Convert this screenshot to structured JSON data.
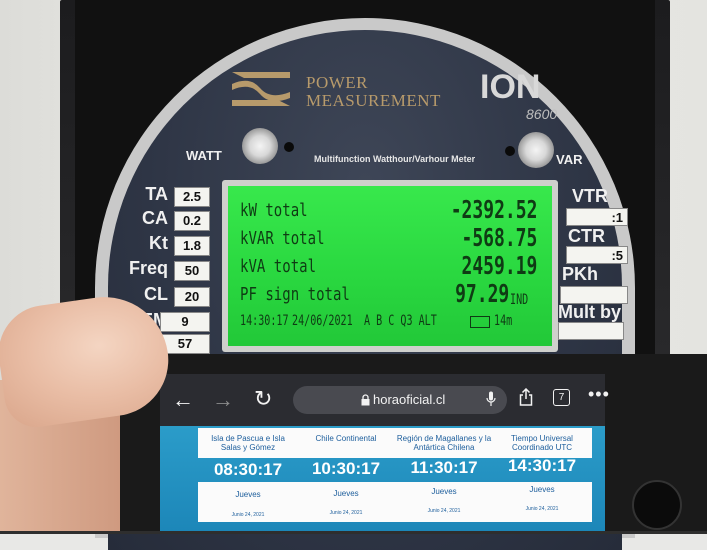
{
  "meter": {
    "brand_line1": "POWER",
    "brand_line2": "MEASUREMENT",
    "model_name": "ION",
    "model_number": "8600",
    "subtitle": "Multifunction Watthour/Varhour Meter",
    "watt_label": "WATT",
    "var_label": "VAR",
    "left_panel": [
      {
        "label": "TA",
        "value": "2.5"
      },
      {
        "label": "CA",
        "value": "0.2"
      },
      {
        "label": "Kt",
        "value": "1.8"
      },
      {
        "label": "Freq",
        "value": "50"
      },
      {
        "label": "CL",
        "value": "20"
      },
      {
        "label": "EM",
        "value": "9"
      },
      {
        "label": "~",
        "value": "57"
      }
    ],
    "right_panel": [
      {
        "label": "VTR",
        "value": ":1"
      },
      {
        "label": "CTR",
        "value": ":5"
      },
      {
        "label": "PKh",
        "value": ""
      },
      {
        "label": "Mult by",
        "value": ""
      }
    ]
  },
  "lcd": {
    "rows": [
      {
        "label": "kW total",
        "value": "-2392.52"
      },
      {
        "label": "kVAR total",
        "value": "-568.75"
      },
      {
        "label": "kVA total",
        "value": "2459.19"
      },
      {
        "label": "PF sign total",
        "value": "97.29",
        "unit": "IND"
      }
    ],
    "status_time": "14:30:17",
    "status_date": "24/06/2021",
    "status_flags": "A B C  Q3  ALT",
    "status_interval": "14m"
  },
  "browser": {
    "url": "horaoficial.cl",
    "tab_count": "7",
    "icons": [
      "back-arrow-icon",
      "forward-arrow-icon",
      "reload-icon",
      "lock-icon",
      "mic-icon",
      "share-icon",
      "more-icon"
    ]
  },
  "timezones": [
    {
      "name": "Isla de Pascua e Isla Salas y Gómez",
      "time": "08:30:17",
      "day": "Jueves",
      "date": "Junio 24, 2021"
    },
    {
      "name": "Chile Continental",
      "time": "10:30:17",
      "day": "Jueves",
      "date": "Junio 24, 2021"
    },
    {
      "name": "Región de Magallanes y la Antártica Chilena",
      "time": "11:30:17",
      "day": "Jueves",
      "date": "Junio 24, 2021"
    },
    {
      "name": "Tiempo Universal Coordinado UTC",
      "time": "14:30:17",
      "day": "Jueves",
      "date": "Junio 24, 2021"
    }
  ],
  "colors": {
    "lcd_green": "#2ad840",
    "meter_face": "#2e3545",
    "brand_gold": "#b79a6b",
    "site_blue": "#1c86b8"
  }
}
